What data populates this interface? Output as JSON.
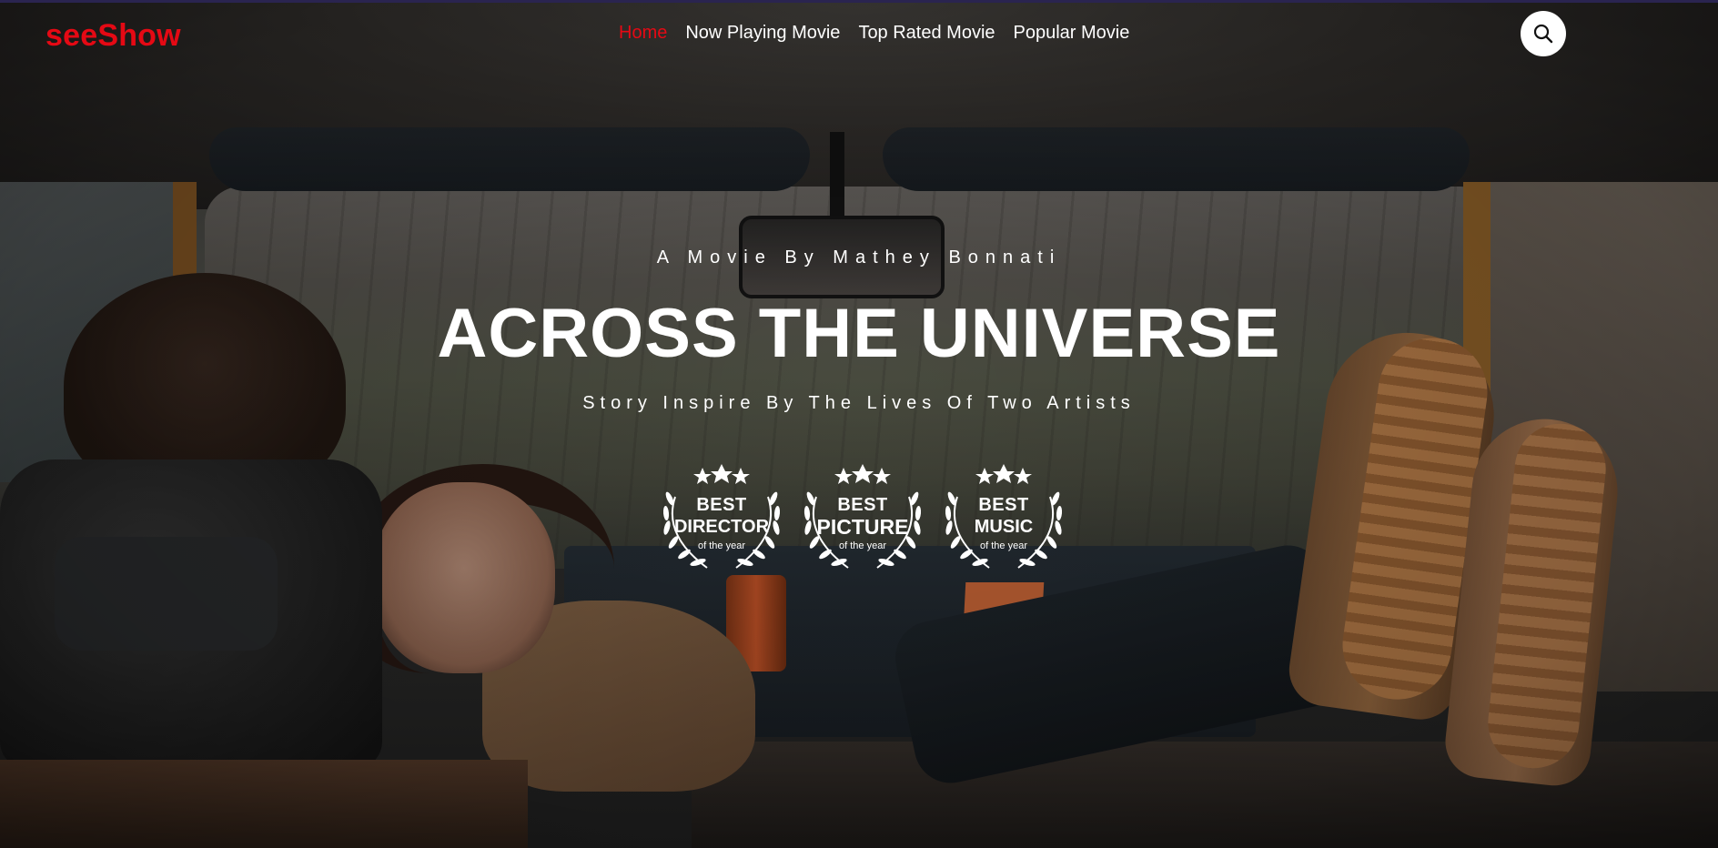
{
  "header": {
    "logo": "seeShow",
    "nav": [
      {
        "label": "Home",
        "active": true
      },
      {
        "label": "Now Playing Movie",
        "active": false
      },
      {
        "label": "Top Rated Movie",
        "active": false
      },
      {
        "label": "Popular Movie",
        "active": false
      }
    ],
    "search_icon": "search-icon"
  },
  "hero": {
    "byline": "A Movie By Mathey Bonnati",
    "title": "ACROSS THE UNIVERSE",
    "tagline": "Story Inspire By The Lives Of Two Artists",
    "awards": [
      {
        "line1": "BEST",
        "line2": "DIRECTOR",
        "line3": "of the year"
      },
      {
        "line1": "BEST",
        "line2": "PICTURE",
        "line3": "of the year"
      },
      {
        "line1": "BEST",
        "line2": "MUSIC",
        "line3": "of the year"
      }
    ]
  },
  "colors": {
    "accent": "#e50914",
    "text": "#ffffff",
    "search_button_bg": "#ffffff"
  }
}
